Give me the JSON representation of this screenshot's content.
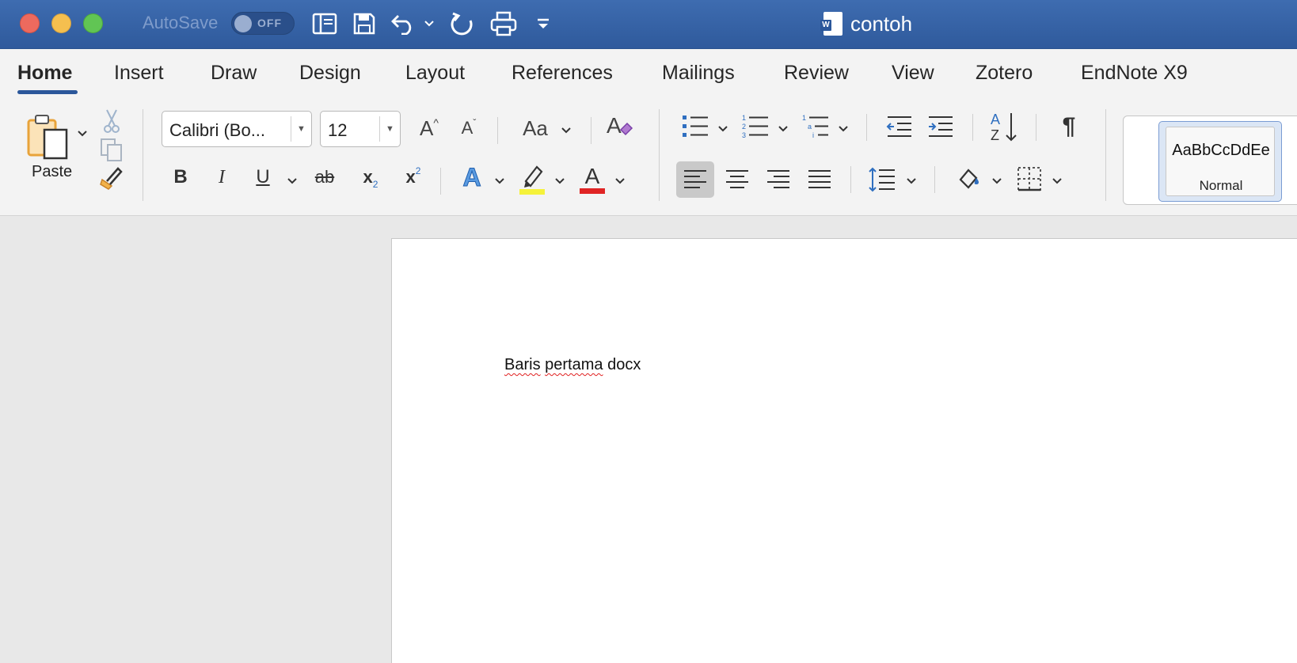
{
  "window": {
    "autosave_label": "AutoSave",
    "autosave_state": "OFF",
    "doc_title": "contoh",
    "word_badge": "W"
  },
  "tabs": [
    {
      "label": "Home",
      "active": true
    },
    {
      "label": "Insert"
    },
    {
      "label": "Draw"
    },
    {
      "label": "Design"
    },
    {
      "label": "Layout"
    },
    {
      "label": "References"
    },
    {
      "label": "Mailings"
    },
    {
      "label": "Review"
    },
    {
      "label": "View"
    },
    {
      "label": "Zotero"
    },
    {
      "label": "EndNote X9"
    }
  ],
  "ribbon": {
    "paste_label": "Paste",
    "font_name": "Calibri (Bo...",
    "font_size": "12",
    "change_case_label": "Aa",
    "bold": "B",
    "italic": "I",
    "underline": "U",
    "strikethrough": "ab",
    "subscript": "x",
    "subscript_mark": "2",
    "superscript": "x",
    "superscript_mark": "2",
    "text_effects": "A",
    "font_color": "A",
    "grow_font": "A",
    "shrink_font": "A",
    "sort_az": "A",
    "sort_z": "Z",
    "pilcrow": "¶",
    "style_preview": "AaBbCcDdEe",
    "style_name": "Normal",
    "highlight_color": "#f5f23a",
    "font_color_swatch": "#e02424"
  },
  "document": {
    "words": [
      {
        "text": "Baris",
        "misspelled": true
      },
      {
        "text": "pertama",
        "misspelled": true
      },
      {
        "text": "docx",
        "misspelled": false
      }
    ]
  }
}
